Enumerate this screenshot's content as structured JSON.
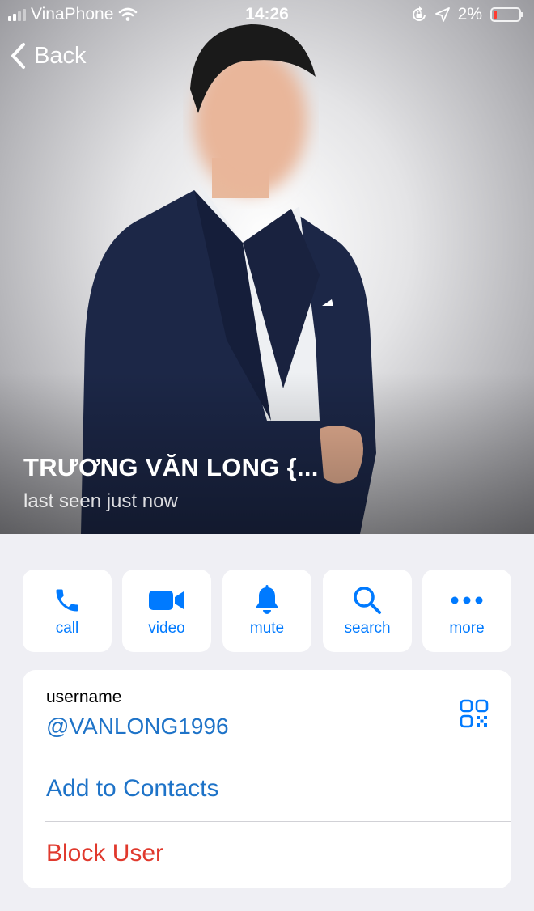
{
  "status_bar": {
    "carrier": "VinaPhone",
    "time": "14:26",
    "battery_percent": "2%",
    "icons": [
      "signal-icon",
      "wifi-icon",
      "orientation-lock-icon",
      "location-icon",
      "battery-icon"
    ]
  },
  "nav": {
    "back_label": "Back"
  },
  "profile": {
    "name": "TRƯƠNG VĂN LONG {...",
    "last_seen": "last seen just now"
  },
  "actions": [
    {
      "label": "call",
      "icon": "phone-icon"
    },
    {
      "label": "video",
      "icon": "video-camera-icon"
    },
    {
      "label": "mute",
      "icon": "bell-icon"
    },
    {
      "label": "search",
      "icon": "search-icon"
    },
    {
      "label": "more",
      "icon": "more-dots-icon"
    }
  ],
  "info": {
    "username_label": "username",
    "username_value": "@VANLONG1996",
    "add_contacts": "Add to Contacts",
    "block_user": "Block User"
  },
  "colors": {
    "accent": "#007aff",
    "link": "#1e73c8",
    "danger": "#e0392d",
    "background": "#efeff4"
  }
}
